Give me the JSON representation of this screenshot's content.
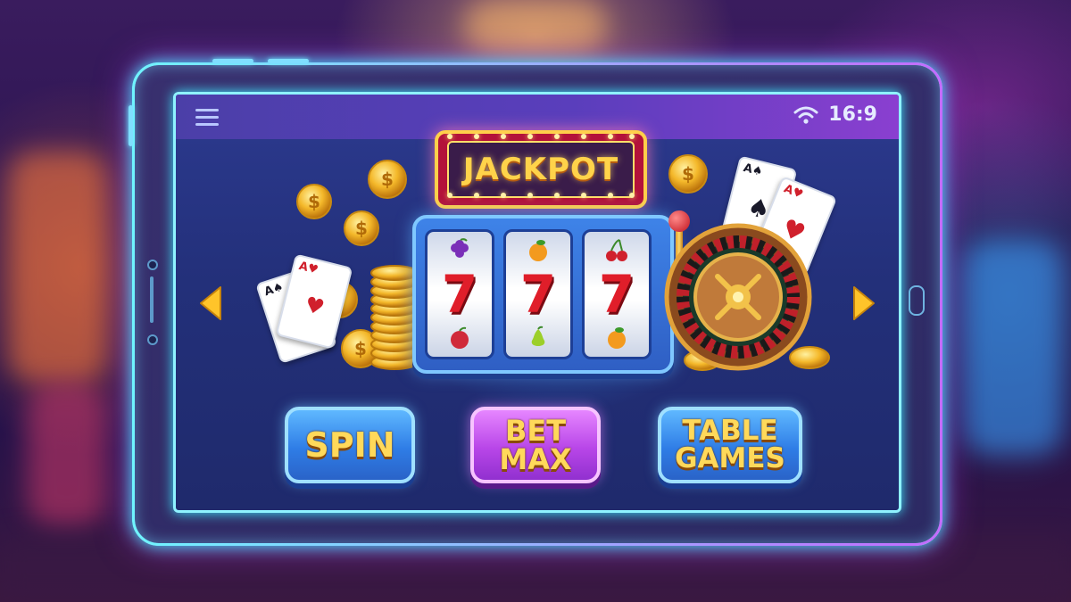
{
  "status_bar": {
    "time": "16:9",
    "icons": [
      "menu-icon",
      "wifi-icon"
    ]
  },
  "marquee": {
    "title": "JACKPOT"
  },
  "slot_machine": {
    "reels": [
      {
        "top": "grapes",
        "middle": "7",
        "bottom": "apple"
      },
      {
        "top": "orange",
        "middle": "7",
        "bottom": "pear"
      },
      {
        "top": "cherries",
        "middle": "7",
        "bottom": "orange"
      }
    ]
  },
  "cards": {
    "left": [
      "A♠",
      "A♥"
    ],
    "right": [
      "A♠",
      "A♥"
    ]
  },
  "navigation": {
    "prev_icon": "chevron-left-icon",
    "next_icon": "chevron-right-icon"
  },
  "buttons": {
    "spin": "SPIN",
    "bet_max": "BET\nMAX",
    "table_games": "TABLE\nGAMES"
  },
  "colors": {
    "neon_cyan": "#8ff3ff",
    "gold": "#ffd34a",
    "spin_blue": "#2f7de6",
    "bet_purple": "#b846e8"
  }
}
